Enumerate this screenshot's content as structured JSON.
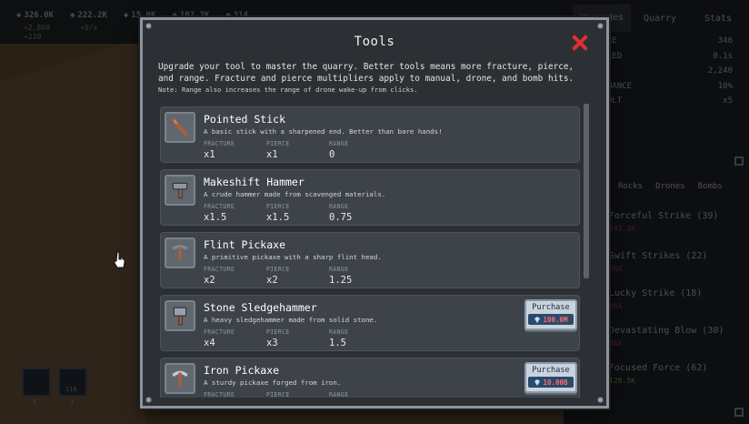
{
  "background": {
    "resources": [
      {
        "icon": "stone-icon",
        "value": "326.0K"
      },
      {
        "icon": "gem-icon",
        "value": "222.2K"
      },
      {
        "icon": "ore-icon",
        "value": "15.0K"
      },
      {
        "icon": "crystal-icon",
        "value": "102.7K"
      },
      {
        "icon": "coal-icon",
        "value": "314"
      }
    ],
    "rates": [
      "+2,800",
      "+210"
    ],
    "rate_gem": "+0/s",
    "slots": [
      {
        "label": "T",
        "count": ""
      },
      {
        "label": "1",
        "count": "116"
      }
    ],
    "side_tabs": [
      "Upgrades",
      "Quarry",
      "Stats"
    ],
    "side_tab_badges": [
      "0",
      "0",
      "0"
    ],
    "side_stats": [
      {
        "label": "RE",
        "value": "346"
      },
      {
        "label": "EED",
        "value": "0.1s"
      },
      {
        "label": "",
        "value": "2,240"
      },
      {
        "label": "HANCE",
        "value": "10%"
      },
      {
        "label": "ULT",
        "value": "x5"
      }
    ],
    "side_subtabs": [
      "Rocks",
      "Drones",
      "Bombs"
    ],
    "side_subtab_badges": [
      "0",
      "0",
      "0"
    ],
    "side_upgrades": [
      {
        "name": "Forceful Strike (39)",
        "cost": "397.2K",
        "gain": "+8"
      },
      {
        "name": "Swift Strikes (22)",
        "cost": "MAX",
        "gain": ""
      },
      {
        "name": "Lucky Strike (18)",
        "cost": "MAX",
        "gain": ""
      },
      {
        "name": "Devastating Blow (30)",
        "cost": "MAX",
        "gain": ""
      },
      {
        "name": "Focused Force (62)",
        "cost": "128.5K",
        "gain": "+35"
      }
    ]
  },
  "modal": {
    "title": "Tools",
    "intro": "Upgrade your tool to master the quarry. Better tools means more fracture, pierce, and range. Fracture and pierce multipliers apply to manual, drone, and bomb hits.",
    "note": "Note: Range also increases the range of drone wake-up from clicks.",
    "stat_labels": {
      "fracture": "FRACTURE",
      "pierce": "PIERCE",
      "range": "RANGE"
    },
    "purchase_label": "Purchase",
    "colors": {
      "price": "#ff6a6a",
      "price_bg": "#2b4a6a",
      "close": "#e03030"
    },
    "tools": [
      {
        "name": "Pointed Stick",
        "icon": "stick-icon",
        "desc": "A basic stick with a sharpened end. Better than bare hands!",
        "fracture": "x1",
        "pierce": "x1",
        "range": "0",
        "price": ""
      },
      {
        "name": "Makeshift Hammer",
        "icon": "hammer-icon",
        "desc": "A crude hammer made from scavenged materials.",
        "fracture": "x1.5",
        "pierce": "x1.5",
        "range": "0.75",
        "price": ""
      },
      {
        "name": "Flint Pickaxe",
        "icon": "pickaxe-icon",
        "desc": "A primitive pickaxe with a sharp flint head.",
        "fracture": "x2",
        "pierce": "x2",
        "range": "1.25",
        "price": ""
      },
      {
        "name": "Stone Sledgehammer",
        "icon": "sledgehammer-icon",
        "desc": "A heavy sledgehammer made from solid stone.",
        "fracture": "x4",
        "pierce": "x3",
        "range": "1.5",
        "price": "100.0M"
      },
      {
        "name": "Iron Pickaxe",
        "icon": "iron-pickaxe-icon",
        "desc": "A sturdy pickaxe forged from iron.",
        "fracture": "",
        "pierce": "",
        "range": "",
        "price": "10.00B"
      }
    ]
  }
}
